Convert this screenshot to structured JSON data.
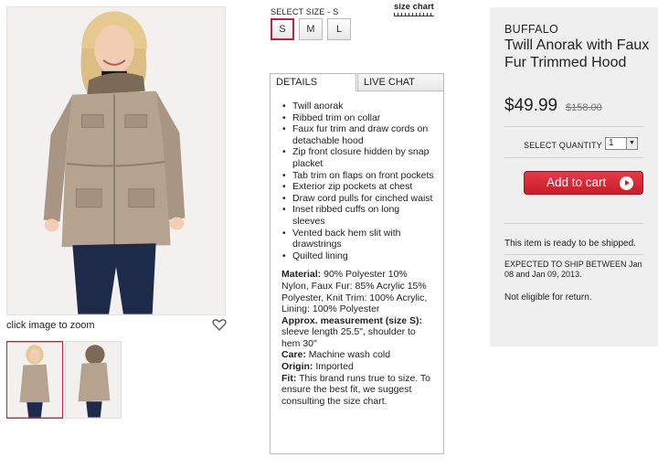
{
  "gallery": {
    "zoom_text": "click image to zoom",
    "icons": {
      "favorite": "heart-icon"
    }
  },
  "size": {
    "label": "SELECT SIZE - S",
    "chart_link": "size chart",
    "options": [
      "S",
      "M",
      "L"
    ],
    "selected": "S"
  },
  "tabs": {
    "details": "DETAILS",
    "chat": "LIVE CHAT"
  },
  "details": {
    "features": [
      "Twill anorak",
      "Ribbed trim on collar",
      "Faux fur trim and draw cords on detachable hood",
      "Zip front closure hidden by snap placket",
      "Tab trim on flaps on front pockets",
      "Exterior zip pockets at chest",
      "Draw cord pulls for cinched waist",
      "Inset ribbed cuffs on long sleeves",
      "Vented back hem slit with drawstrings",
      "Quilted lining"
    ],
    "material_label": "Material:",
    "material": "90% Polyester 10% Nylon, Faux Fur: 85% Acrylic 15% Polyester, Knit Trim: 100% Acrylic, Lining: 100% Polyester",
    "measure_label": "Approx. measurement (size S):",
    "measure": "sleeve length 25.5\", shoulder to hem 30\"",
    "care_label": "Care:",
    "care": "Machine wash cold",
    "origin_label": "Origin:",
    "origin": "Imported",
    "fit_label": "Fit:",
    "fit": "This brand runs true to size. To ensure the best fit, we suggest consulting the size chart."
  },
  "product": {
    "brand": "BUFFALO",
    "title": "Twill Anorak with Faux Fur Trimmed Hood",
    "price": "$49.99",
    "original_price": "$158.00"
  },
  "purchase": {
    "qty_label": "SELECT QUANTITY",
    "qty_value": "1",
    "add_to_cart": "Add to cart",
    "ship_ready": "This item is ready to be shipped.",
    "ship_dates": "EXPECTED TO SHIP BETWEEN Jan 08 and Jan 09, 2013.",
    "return_note": "Not eligible for return."
  },
  "colors": {
    "accent": "#c5203b",
    "cart_button": "#d52a36",
    "panel_bg": "#efefef"
  }
}
